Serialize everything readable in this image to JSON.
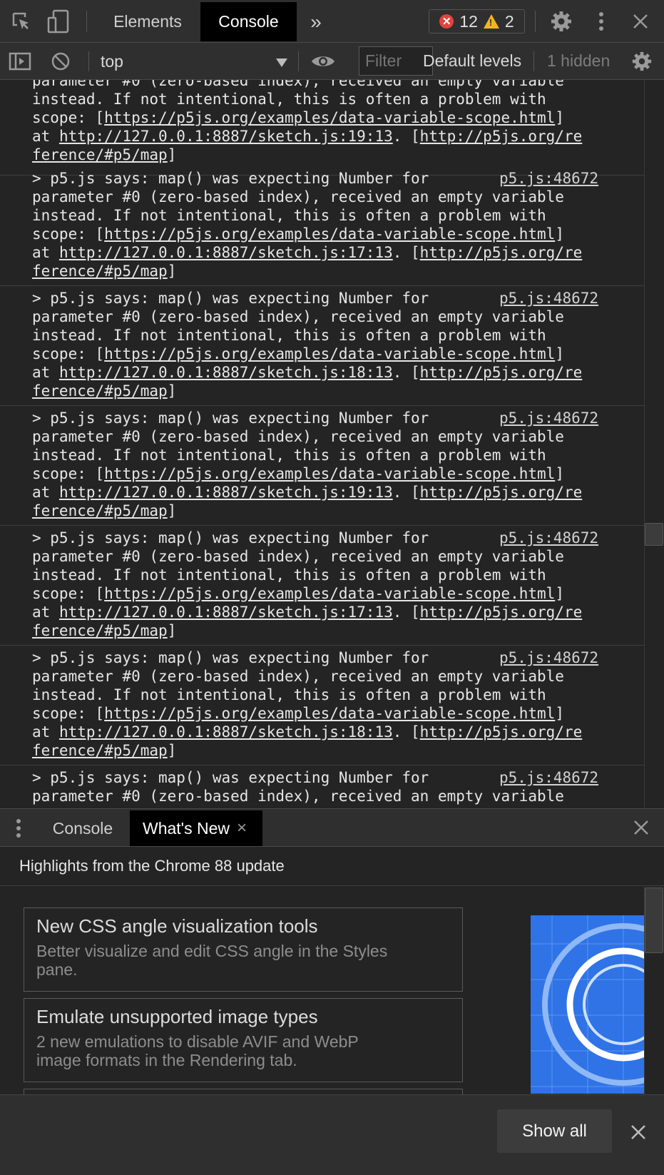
{
  "tabs": {
    "elements": "Elements",
    "console": "Console",
    "more": "»"
  },
  "counters": {
    "errors": "12",
    "warnings": "2"
  },
  "toolbar": {
    "context": "top",
    "filter_placeholder": "Filter",
    "levels": "Default levels",
    "hidden": "1 hidden"
  },
  "messages": {
    "top_partial": [
      "parameter #0 (zero-based index), received an empty variable",
      "instead. If not intentional, this is often a problem with",
      "scope: [",
      "https://p5js.org/examples/data-variable-scope.html",
      "]",
      "at ",
      "http://127.0.0.1:8887/sketch.js:19:13",
      ". [",
      "http://p5js.org/re",
      "ference/#p5/map",
      "]"
    ],
    "lead": "> p5.js says: map() was expecting Number for",
    "line2": "parameter #0 (zero-based index), received an empty variable",
    "line3": "instead. If not intentional, this is often a problem with",
    "scope_prefix": "scope: [",
    "scope_link": "https://p5js.org/examples/data-variable-scope.html",
    "scope_suffix": "]",
    "at_prefix": "at ",
    "ref_mid": ". [",
    "ref_link_a": "http://p5js.org/re",
    "ref_link_b": "ference/#p5/map",
    "ref_suffix": "]",
    "source": "p5.js:48672",
    "items": [
      {
        "at_link": "http://127.0.0.1:8887/sketch.js:17:13"
      },
      {
        "at_link": "http://127.0.0.1:8887/sketch.js:18:13"
      },
      {
        "at_link": "http://127.0.0.1:8887/sketch.js:19:13"
      },
      {
        "at_link": "http://127.0.0.1:8887/sketch.js:17:13"
      },
      {
        "at_link": "http://127.0.0.1:8887/sketch.js:18:13"
      }
    ]
  },
  "drawer": {
    "console_tab": "Console",
    "whats_new_tab": "What's New",
    "close_tab": "×",
    "highlight": "Highlights from the Chrome 88 update",
    "cards": [
      {
        "title": "New CSS angle visualization tools",
        "desc1": "Better visualize and edit CSS angle in the Styles",
        "desc2": "pane."
      },
      {
        "title": "Emulate unsupported image types",
        "desc1": "2 new emulations to disable AVIF and WebP",
        "desc2": "image formats in the Rendering tab."
      }
    ],
    "show_all": "Show all"
  },
  "colors": {
    "error": "#e0443e",
    "warning": "#f2b51e",
    "preview": "#2f73e6"
  },
  "icons": [
    "inspect-icon",
    "device-toggle-icon",
    "gear-icon",
    "kebab-menu-icon",
    "close-icon",
    "sidebar-icon",
    "clear-icon",
    "dropdown-icon",
    "eye-icon"
  ]
}
